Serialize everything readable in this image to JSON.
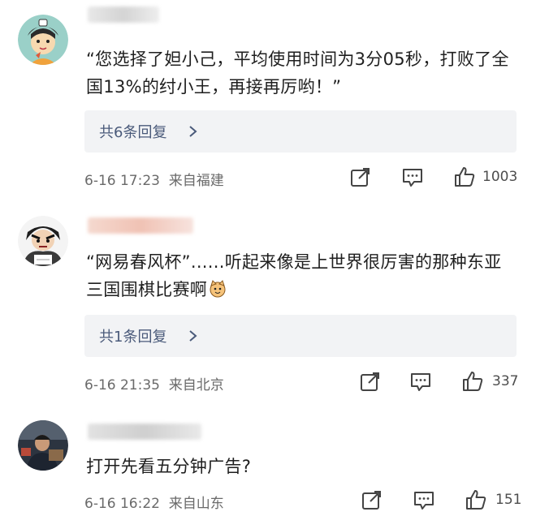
{
  "comments": [
    {
      "text": "“您选择了妲小己，平均使用时间为3分05秒，打败了全国13%的纣小王，再接再厉哟！”",
      "reply_label": "共6条回复",
      "time": "6-16 17:23",
      "location": "来自福建",
      "likes": "1003"
    },
    {
      "text": "“网易春风杯”......听起来像是上世界很厉害的那种东亚三国围棋比赛啊",
      "reply_label": "共1条回复",
      "time": "6-16 21:35",
      "location": "来自北京",
      "likes": "337",
      "emoji": "cat-face-emoji"
    },
    {
      "text": "打开先看五分钟广告?",
      "time": "6-16 16:22",
      "location": "来自山东",
      "likes": "151"
    }
  ],
  "icons": {
    "reply": "chevron-right-icon",
    "share": "share-icon",
    "comment": "comment-icon",
    "like": "thumbs-up-icon"
  },
  "colors": {
    "reply_box_bg": "#f2f3f5",
    "reply_text": "#4a5a7a",
    "meta_text": "#6a6a6a"
  }
}
